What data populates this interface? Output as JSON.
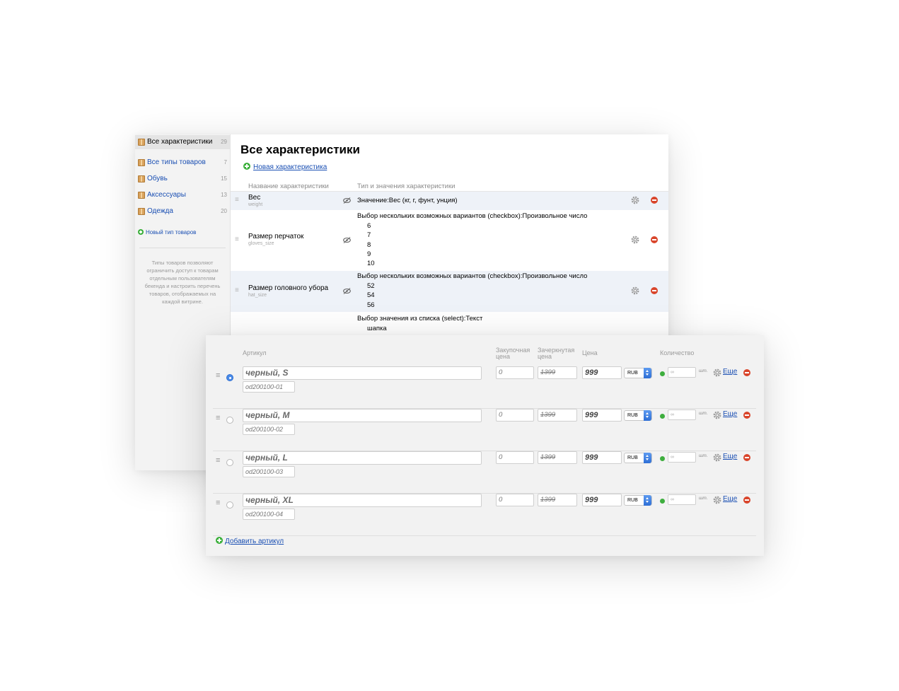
{
  "sidebar": {
    "items": [
      {
        "label": "Все характеристики",
        "count": "29"
      },
      {
        "label": "Все типы товаров",
        "count": "7"
      },
      {
        "label": "Обувь",
        "count": "15"
      },
      {
        "label": "Аксессуары",
        "count": "13"
      },
      {
        "label": "Одежда",
        "count": "20"
      }
    ],
    "add_type": "Новый тип товаров",
    "help": "Типы товаров позволяют ограничить доступ к товарам отдельным пользователям бекенда и настроить перечень товаров, отображаемых на каждой витрине."
  },
  "main": {
    "title": "Все характеристики",
    "new_feature": "Новая характеристика",
    "col_name": "Название характеристики",
    "col_type": "Тип и значения характеристики",
    "features": [
      {
        "name": "Вес",
        "code": "weight",
        "type": "Значение:Вес (кг, г, фунт, унция)",
        "values": []
      },
      {
        "name": "Размер перчаток",
        "code": "gloves_size",
        "type": "Выбор нескольких возможных вариантов (checkbox):Произвольное число",
        "values": [
          "6",
          "7",
          "8",
          "9",
          "10"
        ]
      },
      {
        "name": "Размер головного убора",
        "code": "hat_size",
        "type": "Выбор нескольких возможных вариантов (checkbox):Произвольное число",
        "values": [
          "52",
          "54",
          "56"
        ]
      },
      {
        "name": "",
        "code": "",
        "type": "Выбор значения из списка (select):Текст",
        "values": [
          "шапка"
        ]
      }
    ]
  },
  "skus": {
    "headers": {
      "sku": "Артикул",
      "purchase": "Закупочная цена",
      "compare": "Зачеркнутая цена",
      "price": "Цена",
      "quantity": "Количество"
    },
    "rows": [
      {
        "name": "черный, S",
        "code": "od200100-01",
        "purchase": "0",
        "compare": "1399",
        "price": "999",
        "currency": "RUB",
        "qty": "∞",
        "unit": "шт.",
        "more": "Еще",
        "selected": true
      },
      {
        "name": "черный, M",
        "code": "od200100-02",
        "purchase": "0",
        "compare": "1399",
        "price": "999",
        "currency": "RUB",
        "qty": "∞",
        "unit": "шт.",
        "more": "Еще",
        "selected": false
      },
      {
        "name": "черный, L",
        "code": "od200100-03",
        "purchase": "0",
        "compare": "1399",
        "price": "999",
        "currency": "RUB",
        "qty": "∞",
        "unit": "шт.",
        "more": "Еще",
        "selected": false
      },
      {
        "name": "черный, XL",
        "code": "od200100-04",
        "purchase": "0",
        "compare": "1399",
        "price": "999",
        "currency": "RUB",
        "qty": "∞",
        "unit": "шт.",
        "more": "Еще",
        "selected": false
      }
    ],
    "add_label": "Добавить артикул"
  },
  "icons": {
    "drag": "drag-handle-icon",
    "eye": "eye-hidden-icon",
    "gear": "gear-icon",
    "delete": "delete-icon",
    "plus": "plus-icon",
    "box": "box-icon"
  },
  "colors": {
    "link": "#1a4fb3",
    "green": "#3cb03c",
    "red": "#d9452b",
    "selected_row": "#eef2f8"
  }
}
